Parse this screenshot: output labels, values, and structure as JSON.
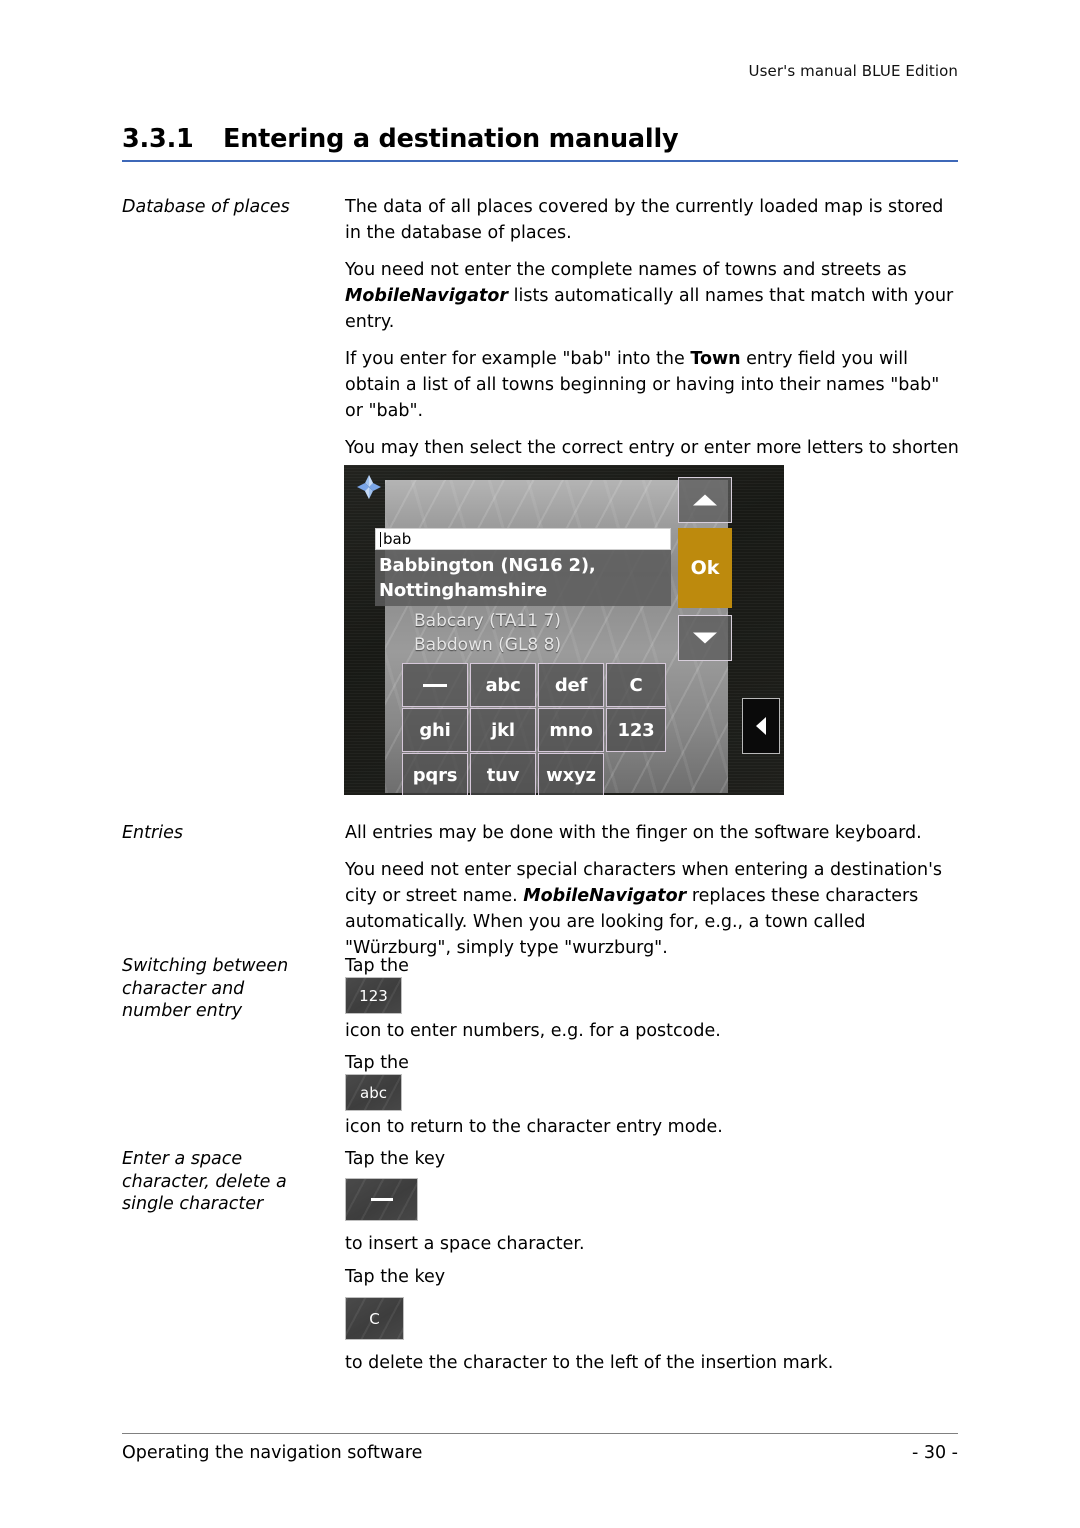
{
  "header": {
    "running_head": "User's manual BLUE Edition",
    "section_number": "3.3.1",
    "section_title": "Entering a destination manually",
    "rule_color": "#3e68b8"
  },
  "sections": {
    "database_of_places": {
      "label": "Database of places",
      "paragraphs": [
        "The data of all places covered by the currently loaded map is stored in the database of places.",
        "You need not enter the complete names of towns and streets as MobileNavigator lists automatically all names that match with your entry.",
        "If you enter for example \"bab\" into the Town entry field you will obtain a list of all towns beginning or having into their names \"bab\" or \"bab\".",
        "You may then select the correct entry or enter more letters to shorten the results list."
      ],
      "p1": "The data of all places covered by the currently loaded map is stored in the database of places.",
      "p2_a": "You need not enter the complete names of towns and streets as ",
      "p2_bold": "MobileNavigator",
      "p2_b": " lists automatically all names that match with your entry.",
      "p3_a": "If you enter for example \"bab\" into the ",
      "p3_bold": "Town",
      "p3_b": " entry field you will obtain a list of all towns beginning or having into their names \"bab\" or \"bab\".",
      "p4": "You may then select the correct entry or enter more letters to shorten the results list."
    },
    "entries": {
      "label": "Entries",
      "p1": "All entries may be done with the finger on the software keyboard.",
      "p2_a": "You need not enter special characters when entering a destination's city or street name. ",
      "p2_bold": "MobileNavigator",
      "p2_b": " replaces these characters automatically. When you are looking for, e.g., a town called \"Würzburg\", simply type \"wurzburg\"."
    },
    "switching": {
      "label_line1": "Switching between",
      "label_line2": "character and",
      "label_line3": "number entry",
      "tap_the_1": "Tap the",
      "icon_123": "123",
      "after_123": "icon to enter numbers, e.g. for a postcode.",
      "tap_the_2": "Tap the",
      "icon_abc": "abc",
      "after_abc": "icon to return to the character entry mode."
    },
    "space_delete": {
      "label_line1": "Enter a space",
      "label_line2": "character, delete a",
      "label_line3": "single character",
      "tap_key_1": "Tap the key",
      "icon_space": "space-underscore",
      "after_space": "to insert a space character.",
      "tap_key_2": "Tap the key",
      "icon_c": "C",
      "after_c": "to delete the character to the left of the insertion mark."
    }
  },
  "device_screenshot": {
    "compass_icon": "compass-arrow-icon",
    "search_value": "bab",
    "selected_result_line1": "Babbington (NG16 2),",
    "selected_result_line2": "Nottinghamshire",
    "results": [
      "Babcary (TA11 7)",
      "Babdown (GL8 8)"
    ],
    "ok_label": "Ok",
    "ok_color": "#bd8a0d",
    "scroll_up_icon": "triangle-up-icon",
    "scroll_down_icon": "triangle-down-icon",
    "back_icon": "triangle-left-icon",
    "keyboard": [
      [
        "_",
        "abc",
        "def",
        "C"
      ],
      [
        "ghi",
        "jkl",
        "mno",
        "123"
      ],
      [
        "pqrs",
        "tuv",
        "wxyz"
      ]
    ],
    "key_space_glyph": "_"
  },
  "footer": {
    "left": "Operating the navigation software",
    "page": "- 30 -"
  }
}
